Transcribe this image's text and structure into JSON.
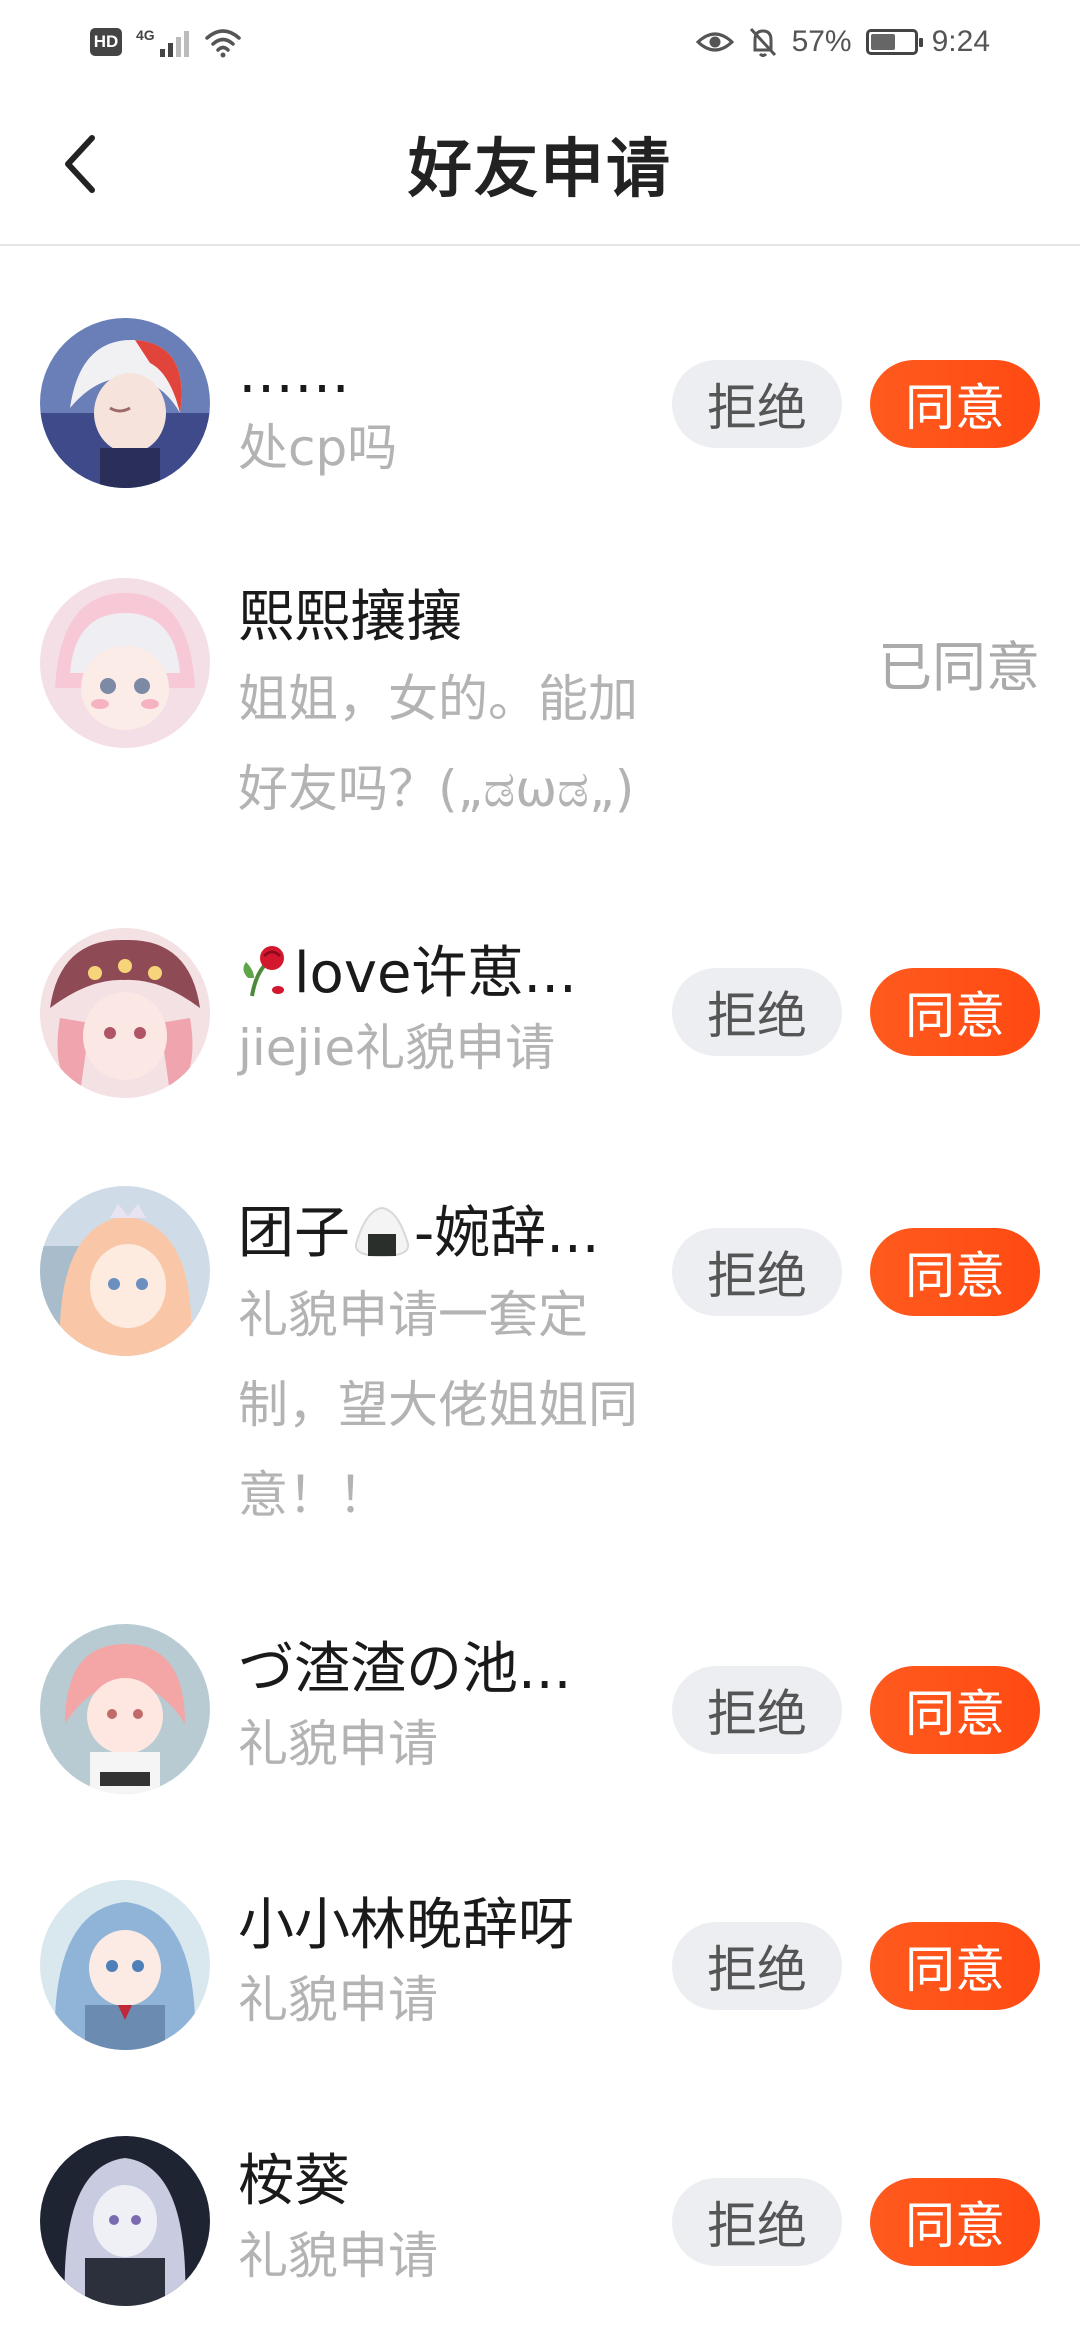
{
  "status_bar": {
    "hd": "HD",
    "network": "4G",
    "battery_percent": "57%",
    "battery_level": 0.57,
    "time": "9:24",
    "icons": [
      "hd-icon",
      "signal-icon",
      "wifi-icon",
      "eye-comfort-icon",
      "mute-bell-icon",
      "battery-icon"
    ]
  },
  "header": {
    "title": "好友申请",
    "back_icon": "chevron-left-icon"
  },
  "actions": {
    "reject": "拒绝",
    "accept": "同意",
    "accepted": "已同意"
  },
  "requests": [
    {
      "name": "……",
      "message": "处cp吗",
      "status": "pending",
      "avatar": "avatar-white-red-hair"
    },
    {
      "name": "熙熙攘攘",
      "message": "姐姐，女的。能加好友吗？(„ಡωಡ„)",
      "status": "accepted",
      "avatar": "avatar-pink-hair-hat"
    },
    {
      "name": "love许葸...",
      "name_prefix_icon": "rose-emoji",
      "message": "jiejie礼貌申请",
      "status": "pending",
      "avatar": "avatar-pink-hair-beret"
    },
    {
      "name_before": "团子",
      "name_icon": "rice-ball-emoji",
      "name_after": "-婉辞...",
      "message": "礼貌申请一套定制，望大佬姐姐同意！！",
      "status": "pending",
      "avatar": "avatar-blonde-crown"
    },
    {
      "name": "づ渣渣の池...",
      "message": "礼貌申请",
      "status": "pending",
      "avatar": "avatar-pink-short-hair"
    },
    {
      "name": "小小林晚辞呀",
      "message": "礼貌申请",
      "status": "pending",
      "avatar": "avatar-blue-hair"
    },
    {
      "name": "桉葵",
      "message": "礼貌申请",
      "status": "pending",
      "avatar": "avatar-silver-hair-dark"
    }
  ]
}
